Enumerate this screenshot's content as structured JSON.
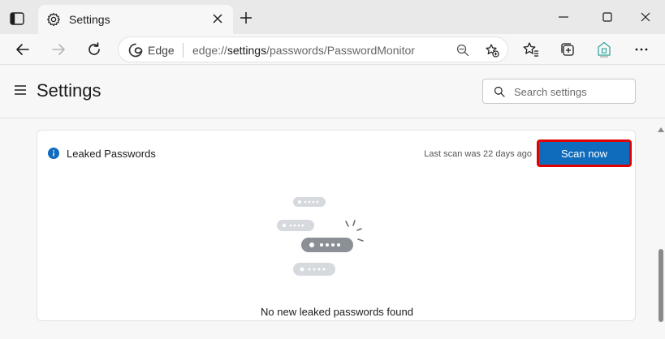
{
  "tab": {
    "title": "Settings",
    "icon": "gear-icon"
  },
  "address_bar": {
    "browser_label": "Edge",
    "url_prefix": "edge://",
    "url_highlight": "settings",
    "url_rest": "/passwords/PasswordMonitor"
  },
  "header": {
    "title": "Settings",
    "search_placeholder": "Search settings"
  },
  "leaked_passwords": {
    "title": "Leaked Passwords",
    "last_scan": "Last scan was 22 days ago",
    "scan_button": "Scan now",
    "empty_message": "No new leaked passwords found"
  },
  "colors": {
    "accent": "#0f6cbd",
    "highlight_border": "#e00000",
    "info_icon": "#0f6cbd"
  }
}
